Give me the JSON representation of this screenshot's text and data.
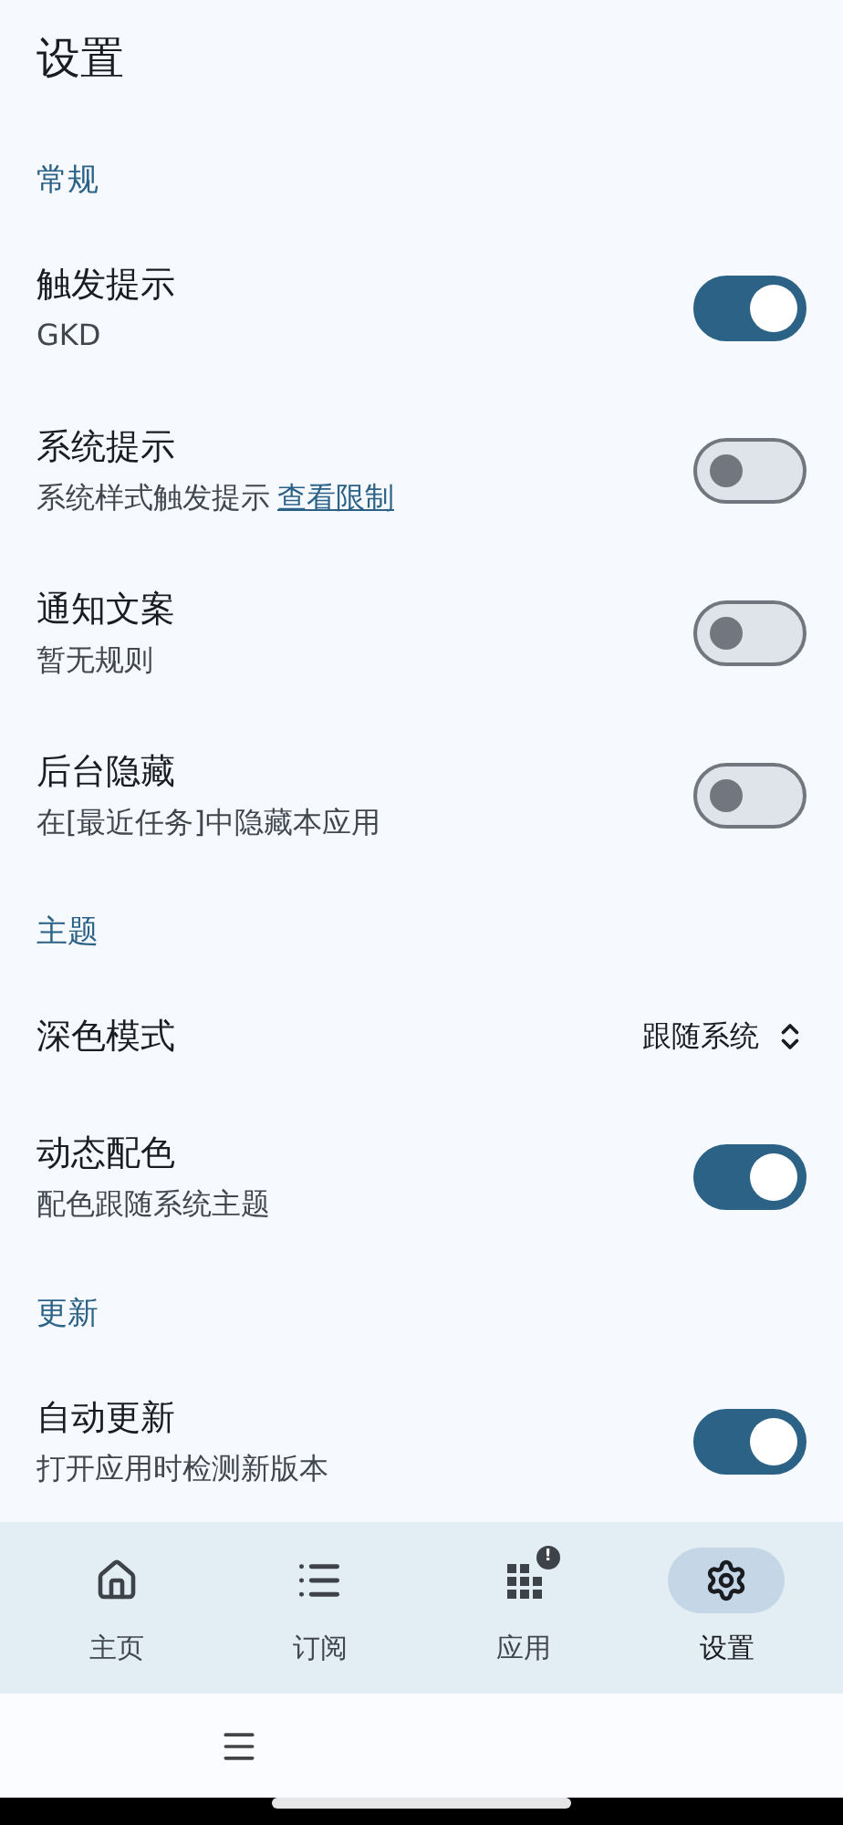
{
  "title": "设置",
  "sections": [
    {
      "header": "常规",
      "items": [
        {
          "kind": "switch",
          "title": "触发提示",
          "subtitle": "GKD",
          "on": true
        },
        {
          "kind": "switch",
          "title": "系统提示",
          "subtitle": "系统样式触发提示",
          "link": "查看限制",
          "on": false
        },
        {
          "kind": "switch",
          "title": "通知文案",
          "subtitle": "暂无规则",
          "on": false
        },
        {
          "kind": "switch",
          "title": "后台隐藏",
          "subtitle": "在[最近任务]中隐藏本应用",
          "on": false
        }
      ]
    },
    {
      "header": "主题",
      "items": [
        {
          "kind": "select",
          "title": "深色模式",
          "value": "跟随系统"
        },
        {
          "kind": "switch",
          "title": "动态配色",
          "subtitle": "配色跟随系统主题",
          "on": true
        }
      ]
    },
    {
      "header": "更新",
      "items": [
        {
          "kind": "switch",
          "title": "自动更新",
          "subtitle": "打开应用时检测新版本",
          "on": true
        }
      ]
    }
  ],
  "nav": [
    {
      "kind": "home",
      "label": "主页",
      "selected": false
    },
    {
      "kind": "list",
      "label": "订阅",
      "selected": false
    },
    {
      "kind": "apps",
      "label": "应用",
      "selected": false,
      "badge": "!"
    },
    {
      "kind": "settings",
      "label": "设置",
      "selected": true
    }
  ]
}
